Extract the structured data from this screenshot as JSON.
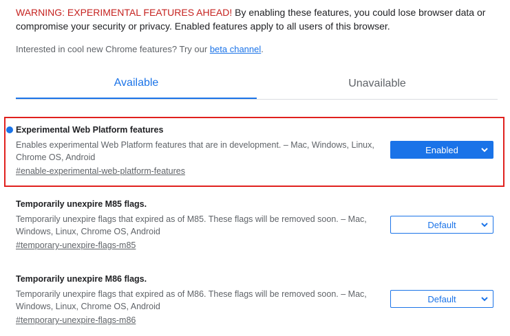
{
  "warning": {
    "title": "WARNING: EXPERIMENTAL FEATURES AHEAD!",
    "text": " By enabling these features, you could lose browser data or compromise your security or privacy. Enabled features apply to all users of this browser."
  },
  "beta": {
    "prefix": "Interested in cool new Chrome features? Try our ",
    "link": "beta channel",
    "suffix": "."
  },
  "tabs": [
    {
      "label": "Available",
      "selected": true
    },
    {
      "label": "Unavailable",
      "selected": false
    }
  ],
  "flags": [
    {
      "title": "Experimental Web Platform features",
      "description": "Enables experimental Web Platform features that are in development. – Mac, Windows, Linux, Chrome OS, Android",
      "anchor": "#enable-experimental-web-platform-features",
      "value": "Enabled",
      "modified": true
    },
    {
      "title": "Temporarily unexpire M85 flags.",
      "description": "Temporarily unexpire flags that expired as of M85. These flags will be removed soon. – Mac, Windows, Linux, Chrome OS, Android",
      "anchor": "#temporary-unexpire-flags-m85",
      "value": "Default",
      "modified": false
    },
    {
      "title": "Temporarily unexpire M86 flags.",
      "description": "Temporarily unexpire flags that expired as of M86. These flags will be removed soon. – Mac, Windows, Linux, Chrome OS, Android",
      "anchor": "#temporary-unexpire-flags-m86",
      "value": "Default",
      "modified": false
    }
  ],
  "colors": {
    "accent": "#1a73e8",
    "warning": "#c5221f",
    "highlight_border": "#e0201d"
  }
}
